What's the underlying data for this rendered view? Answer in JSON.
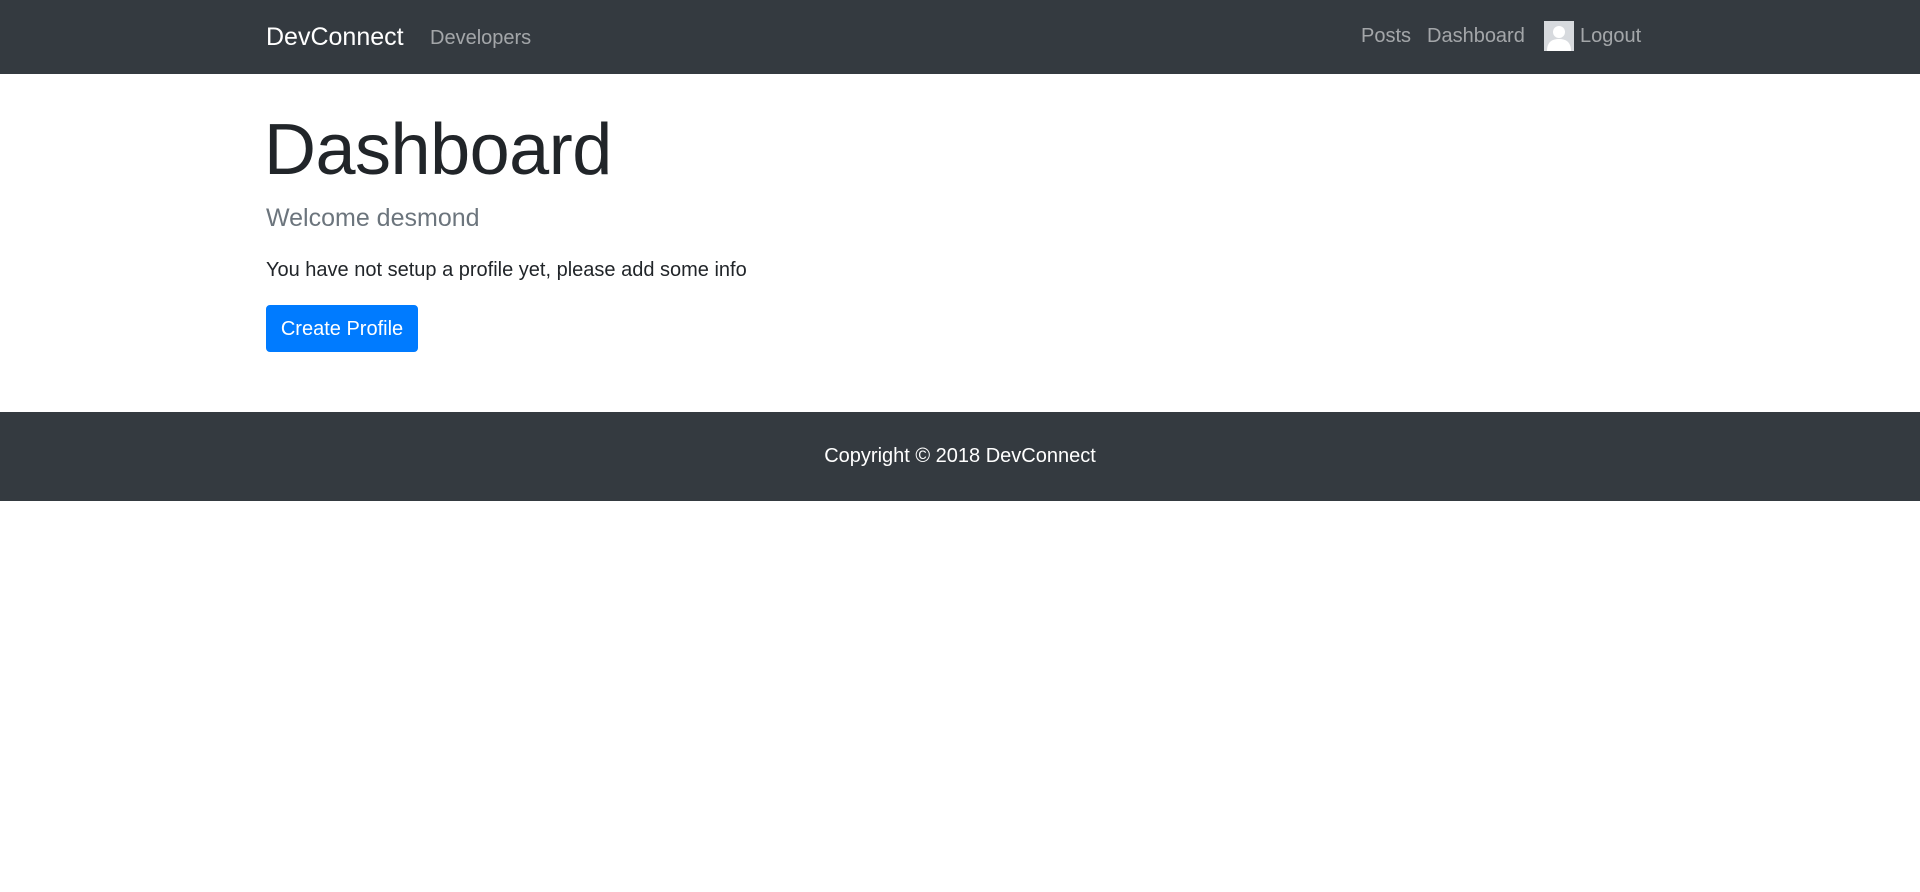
{
  "navbar": {
    "brand": "DevConnect",
    "left_links": [
      {
        "label": "Developers"
      }
    ],
    "right_links": [
      {
        "label": "Posts"
      },
      {
        "label": "Dashboard"
      }
    ],
    "logout": {
      "label": "Logout",
      "avatar_icon": "user-avatar-icon"
    }
  },
  "main": {
    "title": "Dashboard",
    "welcome": "Welcome desmond",
    "info": "You have not setup a profile yet, please add some info",
    "create_button": "Create Profile"
  },
  "footer": {
    "copyright": "Copyright © 2018 DevConnect"
  },
  "colors": {
    "navbar_bg": "#343a40",
    "primary": "#007bff",
    "muted": "#6c757d"
  }
}
